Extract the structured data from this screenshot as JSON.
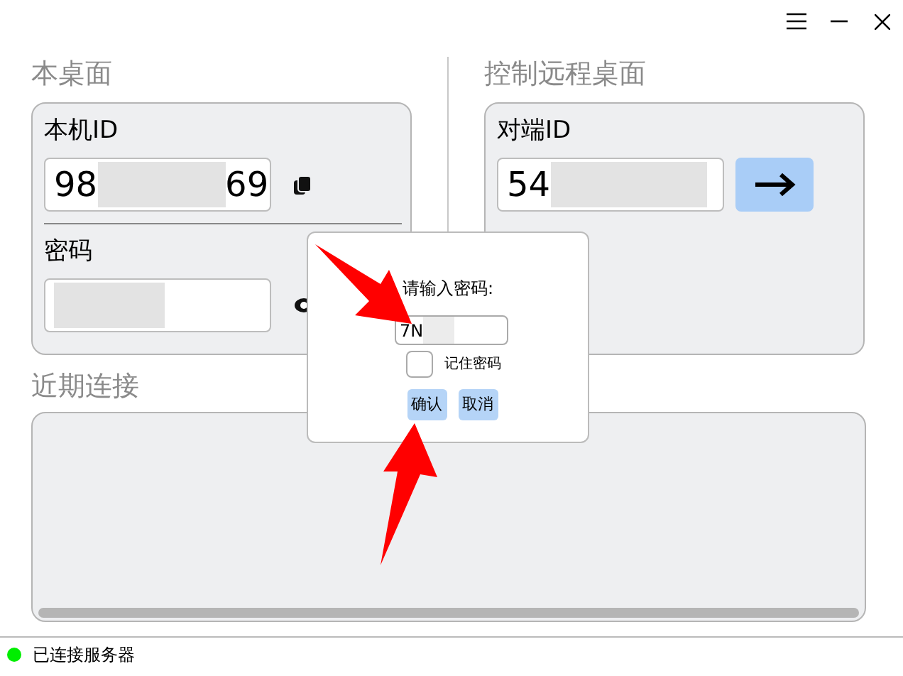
{
  "local": {
    "title": "本桌面",
    "id_label": "本机ID",
    "id_parts": [
      "98",
      "69"
    ],
    "password_label": "密码"
  },
  "remote": {
    "title": "控制远程桌面",
    "id_label": "对端ID",
    "id_parts": [
      "54"
    ]
  },
  "recent": {
    "title": "近期连接"
  },
  "dialog": {
    "prompt": "请输入密码:",
    "value": "7N",
    "remember": {
      "label": "记住密码",
      "checked": false
    },
    "buttons": [
      "确认",
      "取消"
    ]
  },
  "status": {
    "text": "已连接服务器",
    "connected": true
  }
}
